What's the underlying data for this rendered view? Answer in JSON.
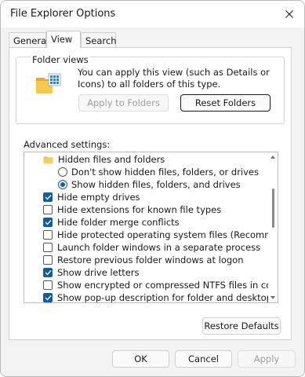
{
  "window": {
    "title": "File Explorer Options"
  },
  "tabs": [
    {
      "label": "General"
    },
    {
      "label": "View"
    },
    {
      "label": "Search"
    }
  ],
  "folder_views": {
    "group_label": "Folder views",
    "description": "You can apply this view (such as Details or Icons) to all folders of this type.",
    "apply_label": "Apply to Folders",
    "reset_label": "Reset Folders"
  },
  "advanced": {
    "label": "Advanced settings:",
    "items": [
      {
        "type": "folder",
        "label": "Hidden files and folders"
      },
      {
        "type": "radio",
        "checked": false,
        "label": "Don't show hidden files, folders, or drives"
      },
      {
        "type": "radio",
        "checked": true,
        "label": "Show hidden files, folders, and drives"
      },
      {
        "type": "checkbox",
        "checked": true,
        "label": "Hide empty drives"
      },
      {
        "type": "checkbox",
        "checked": false,
        "label": "Hide extensions for known file types"
      },
      {
        "type": "checkbox",
        "checked": true,
        "label": "Hide folder merge conflicts"
      },
      {
        "type": "checkbox",
        "checked": false,
        "label": "Hide protected operating system files (Recommended)"
      },
      {
        "type": "checkbox",
        "checked": false,
        "label": "Launch folder windows in a separate process"
      },
      {
        "type": "checkbox",
        "checked": false,
        "label": "Restore previous folder windows at logon"
      },
      {
        "type": "checkbox",
        "checked": true,
        "label": "Show drive letters"
      },
      {
        "type": "checkbox",
        "checked": false,
        "label": "Show encrypted or compressed NTFS files in color"
      },
      {
        "type": "checkbox",
        "checked": true,
        "label": "Show pop-up description for folder and desktop items"
      }
    ],
    "restore_label": "Restore Defaults"
  },
  "footer": {
    "ok_label": "OK",
    "cancel_label": "Cancel",
    "apply_label": "Apply"
  },
  "colors": {
    "accent": "#0b5cad",
    "folder": "#e8b84a"
  }
}
